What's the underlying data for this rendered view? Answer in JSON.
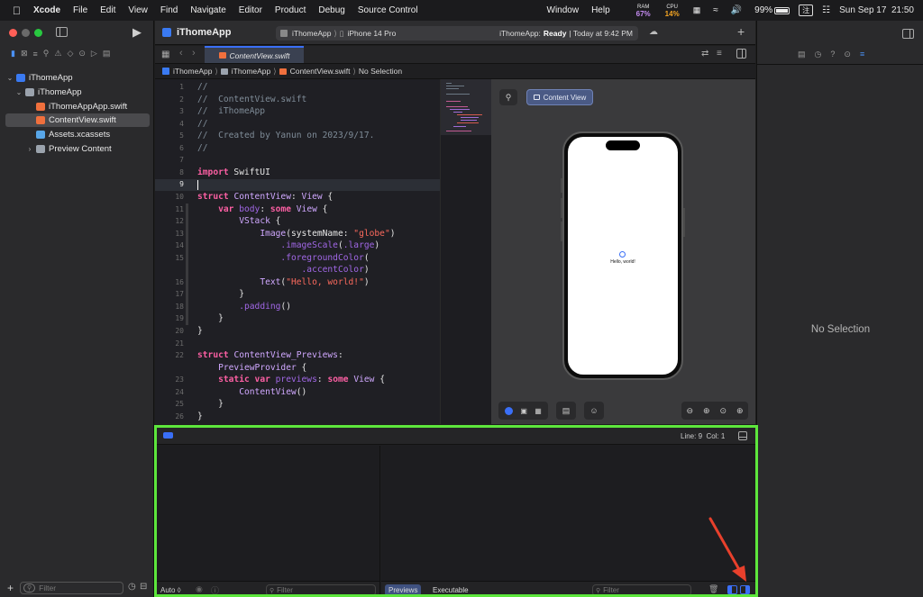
{
  "menubar": {
    "app": "Xcode",
    "items": [
      "File",
      "Edit",
      "View",
      "Find",
      "Navigate",
      "Editor",
      "Product",
      "Debug",
      "Source Control"
    ],
    "right_items": [
      "Window",
      "Help"
    ],
    "ram_label": "RAM",
    "ram_value": "67%",
    "cpu_label": "CPU",
    "cpu_value": "14%",
    "battery": "99%",
    "input_method": "注",
    "datetime": "Sun Sep 17  21:50"
  },
  "toolbar": {
    "project": "iThomeApp",
    "scheme": "iThomeApp",
    "device": "iPhone 14 Pro",
    "status_app": "iThomeApp:",
    "status_state": "Ready",
    "status_time": "| Today at 9:42 PM"
  },
  "navigator": {
    "items": [
      {
        "label": "iThomeApp",
        "level": 0,
        "type": "project"
      },
      {
        "label": "iThomeApp",
        "level": 1,
        "type": "folder"
      },
      {
        "label": "iThomeAppApp.swift",
        "level": 2,
        "type": "swift"
      },
      {
        "label": "ContentView.swift",
        "level": 2,
        "type": "swift",
        "selected": true
      },
      {
        "label": "Assets.xcassets",
        "level": 2,
        "type": "assets"
      },
      {
        "label": "Preview Content",
        "level": 2,
        "type": "folder"
      }
    ],
    "filter_placeholder": "Filter"
  },
  "editor": {
    "tab": "ContentView.swift",
    "breadcrumb": [
      "iThomeApp",
      "iThomeApp",
      "ContentView.swift",
      "No Selection"
    ],
    "line_numbers": [
      "1",
      "2",
      "3",
      "4",
      "5",
      "6",
      "7",
      "8",
      "9",
      "10",
      "11",
      "12",
      "13",
      "14",
      "15",
      "",
      "16",
      "17",
      "18",
      "19",
      "20",
      "21",
      "22",
      "",
      "23",
      "24",
      "25",
      "26"
    ],
    "lines": [
      {
        "n": "1",
        "t": "//"
      },
      {
        "n": "2",
        "t": "//  ContentView.swift"
      },
      {
        "n": "3",
        "t": "//  iThomeApp"
      },
      {
        "n": "4",
        "t": "//"
      },
      {
        "n": "5",
        "t": "//  Created by Yanun on 2023/9/17."
      },
      {
        "n": "6",
        "t": "//"
      },
      {
        "n": "7",
        "t": ""
      },
      {
        "n": "8",
        "t": "import SwiftUI"
      },
      {
        "n": "9",
        "t": ""
      },
      {
        "n": "10",
        "t": "struct ContentView: View {"
      },
      {
        "n": "11",
        "t": "    var body: some View {"
      },
      {
        "n": "12",
        "t": "        VStack {"
      },
      {
        "n": "13",
        "t": "            Image(systemName: \"globe\")"
      },
      {
        "n": "14",
        "t": "                .imageScale(.large)"
      },
      {
        "n": "15",
        "t": "                .foregroundColor("
      },
      {
        "n": "",
        "t": "                    .accentColor)"
      },
      {
        "n": "16",
        "t": "            Text(\"Hello, world!\")"
      },
      {
        "n": "17",
        "t": "        }"
      },
      {
        "n": "18",
        "t": "        .padding()"
      },
      {
        "n": "19",
        "t": "    }"
      },
      {
        "n": "20",
        "t": "}"
      },
      {
        "n": "21",
        "t": ""
      },
      {
        "n": "22",
        "t": "struct ContentView_Previews:"
      },
      {
        "n": "",
        "t": "    PreviewProvider {"
      },
      {
        "n": "23",
        "t": "    static var previews: some View {"
      },
      {
        "n": "24",
        "t": "        ContentView()"
      },
      {
        "n": "25",
        "t": "    }"
      },
      {
        "n": "26",
        "t": "}"
      }
    ]
  },
  "canvas": {
    "preview_tab": "Content View",
    "hello": "Hello, world!"
  },
  "inspector": {
    "empty": "No Selection"
  },
  "debug": {
    "line_col": "Line: 9  Col: 1",
    "auto": "Auto ◊",
    "filter_placeholder": "Filter",
    "tab_previews": "Previews",
    "tab_executable": "Executable"
  },
  "colors": {
    "highlight_green": "#5de63c",
    "arrow_red": "#e8402c",
    "accent_blue": "#3a6ff7"
  }
}
